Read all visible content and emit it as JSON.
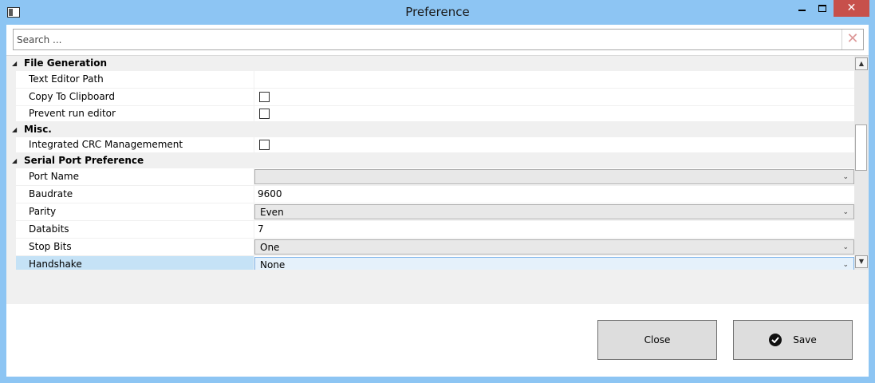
{
  "window": {
    "title": "Preference",
    "close_glyph": "✕",
    "icon": "app-window-icon"
  },
  "search": {
    "placeholder": "Search ...",
    "value": "",
    "clear_glyph": "✕"
  },
  "categories": [
    {
      "name": "File Generation",
      "properties": [
        {
          "name": "Text Editor Path",
          "kind": "text",
          "value": ""
        },
        {
          "name": "Copy To Clipboard",
          "kind": "checkbox",
          "checked": false
        },
        {
          "name": "Prevent run editor",
          "kind": "checkbox",
          "checked": false
        }
      ]
    },
    {
      "name": "Misc.",
      "properties": [
        {
          "name": "Integrated CRC Managemement",
          "kind": "checkbox",
          "checked": false
        }
      ]
    },
    {
      "name": "Serial Port Preference",
      "properties": [
        {
          "name": "Port Name",
          "kind": "combo",
          "value": ""
        },
        {
          "name": "Baudrate",
          "kind": "text",
          "value": "9600"
        },
        {
          "name": "Parity",
          "kind": "combo",
          "value": "Even"
        },
        {
          "name": "Databits",
          "kind": "text",
          "value": "7"
        },
        {
          "name": "Stop Bits",
          "kind": "combo",
          "value": "One"
        },
        {
          "name": "Handshake",
          "kind": "combo",
          "value": "None",
          "selected": true
        }
      ]
    }
  ],
  "glyphs": {
    "expanded": "◢",
    "combo_arrow": "⌄",
    "scroll_up": "▲",
    "scroll_down": "▼"
  },
  "buttons": {
    "close_label": "Close",
    "save_label": "Save",
    "save_icon": "check-circle-icon"
  },
  "colors": {
    "titlebar": "#8dc5f3",
    "close_button": "#c7504b",
    "selection": "#c5e2f6"
  }
}
